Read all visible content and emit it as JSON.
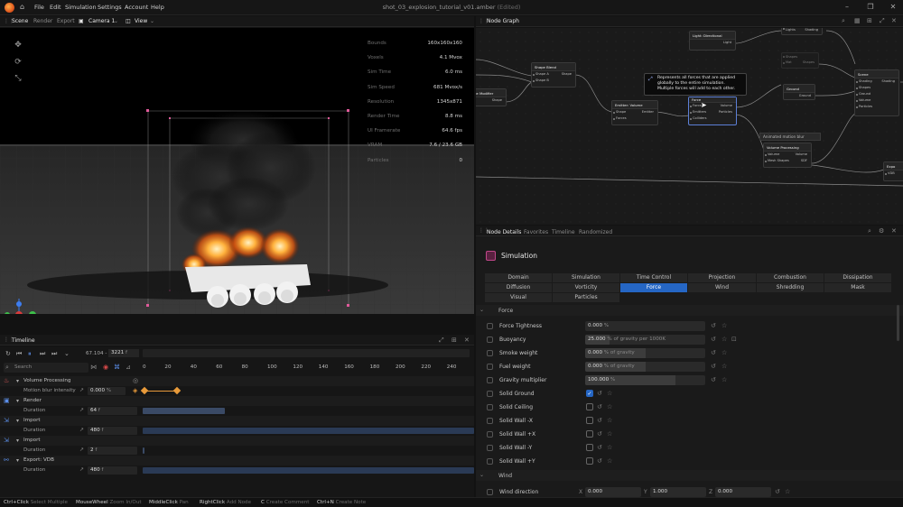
{
  "app": {
    "title": "shot_03_explosion_tutorial_v01.amber",
    "edited": "(Edited)",
    "menus": [
      "File",
      "Edit",
      "Simulation",
      "Settings",
      "Account",
      "Help"
    ]
  },
  "viewport": {
    "tabs": {
      "scene": "Scene",
      "render": "Render",
      "export": "Export"
    },
    "camera": "Camera 1",
    "view": "View",
    "stats": [
      {
        "k": "Bounds",
        "v": "160x160x160"
      },
      {
        "k": "Voxels",
        "v": "4.1 Mvox"
      },
      {
        "k": "Sim Time",
        "v": "6.0 ms"
      },
      {
        "k": "Sim Speed",
        "v": "681 Mvox/s"
      },
      {
        "k": "Resolution",
        "v": "1345x871"
      },
      {
        "k": "Render Time",
        "v": "8.8 ms"
      },
      {
        "k": "UI Framerate",
        "v": "64.6 fps"
      },
      {
        "k": "VRAM",
        "v": "7.6 / 23.6 GB"
      },
      {
        "k": "Particles",
        "v": "0"
      }
    ]
  },
  "graph": {
    "title": "Node Graph",
    "tooltip": "Represents all forces that are applied globally to the entire simulation. Multiple forces will add to each other.",
    "amb_label": "Animated motion blur",
    "nodes": {
      "shape_modifier": {
        "title": "pe Modifier",
        "r1": "Shape"
      },
      "shape_blend": {
        "title": "Shape Blend",
        "r1": "Shape A",
        "r1o": "Shape",
        "r2": "Shape B"
      },
      "emitter_volume": {
        "title": "Emitter: Volume",
        "r1": "Shape",
        "r1o": "Emitter",
        "r2": "Forces"
      },
      "force": {
        "title": "Force",
        "r1": "Forces",
        "r1o": "Volume",
        "r2": "Emitters",
        "r2o": "Particles",
        "r3": "Colliders"
      },
      "light_dir": {
        "title": "Light: Directional",
        "r1o": "Light"
      },
      "lights": {
        "r1": "Lights",
        "r1o": "Shading"
      },
      "shapes": {
        "r1": "Shapes",
        "r2": "Mat",
        "r2o": "Shapes"
      },
      "ground": {
        "title": "Ground",
        "r1o": "Ground"
      },
      "volume_processing": {
        "title": "Volume Processing",
        "r1": "Volume",
        "r1o": "Volume",
        "r2": "Mesh Shapes",
        "r2o": "SDF"
      },
      "scene": {
        "title": "Scene",
        "r1": "Shading",
        "r1o": "Shading",
        "r2": "Shapes",
        "r3": "Ground",
        "r4": "Volume",
        "r5": "Particles"
      },
      "export": {
        "title": "Expo",
        "r1": "VDB"
      }
    }
  },
  "details": {
    "tabs": {
      "node_details": "Node Details",
      "favorites": "Favorites",
      "timeline": "Timeline",
      "randomized": "Randomized"
    },
    "title": "Simulation",
    "categories": [
      [
        "Domain",
        "Simulation",
        "Time Control",
        "Projection",
        "Combustion",
        "Dissipation"
      ],
      [
        "Diffusion",
        "Vorticity",
        "Force",
        "Wind",
        "Shredding",
        "Mask"
      ],
      [
        "Visual",
        "Particles"
      ]
    ],
    "section_force": "Force",
    "section_wind": "Wind",
    "props": [
      {
        "label": "Force Tightness",
        "value": "0.000",
        "unit": "%"
      },
      {
        "label": "Buoyancy",
        "value": "25.000",
        "unit": "% of gravity per 1000K"
      },
      {
        "label": "Smoke weight",
        "value": "0.000",
        "unit": "% of gravity"
      },
      {
        "label": "Fuel weight",
        "value": "0.000",
        "unit": "% of gravity"
      },
      {
        "label": "Gravity multiplier",
        "value": "100.000",
        "unit": "%"
      }
    ],
    "checks": [
      {
        "label": "Solid Ground",
        "checked": true
      },
      {
        "label": "Solid Ceiling",
        "checked": false
      },
      {
        "label": "Solid Wall -X",
        "checked": false
      },
      {
        "label": "Solid Wall +X",
        "checked": false
      },
      {
        "label": "Solid Wall -Y",
        "checked": false
      },
      {
        "label": "Solid Wall +Y",
        "checked": false
      }
    ],
    "wind": {
      "label": "Wind direction",
      "xl": "X",
      "x": "0.000",
      "yl": "Y",
      "y": "1.000",
      "zl": "Z",
      "z": "0.000"
    }
  },
  "timeline": {
    "title": "Timeline",
    "fps": "67.104 -",
    "frame": "3221",
    "frame_unit": "f",
    "search": "Search",
    "ticks": [
      "0",
      "20",
      "40",
      "60",
      "80",
      "100",
      "120",
      "140",
      "160",
      "180",
      "200",
      "220",
      "240"
    ],
    "rows": {
      "vp": "Volume Processing",
      "mb": "Motion blur intensity",
      "mb_val": "0.000",
      "mb_unit": "%",
      "render": "Render",
      "import1": "Import",
      "import2": "Import",
      "export": "Export: VDB",
      "dur": "Duration",
      "render_dur": "64",
      "import1_dur": "480",
      "import2_dur": "2",
      "export_dur": "480",
      "unit": "f"
    }
  },
  "statusbar": [
    {
      "k": "Ctrl+Click",
      "v": "Select Multiple"
    },
    {
      "k": "MouseWheel",
      "v": "Zoom In/Out"
    },
    {
      "k": "MiddleClick",
      "v": "Pan"
    },
    {
      "k": "RightClick",
      "v": "Add Node"
    },
    {
      "k": "C",
      "v": "Create Comment"
    },
    {
      "k": "Ctrl+N",
      "v": "Create Note"
    }
  ]
}
